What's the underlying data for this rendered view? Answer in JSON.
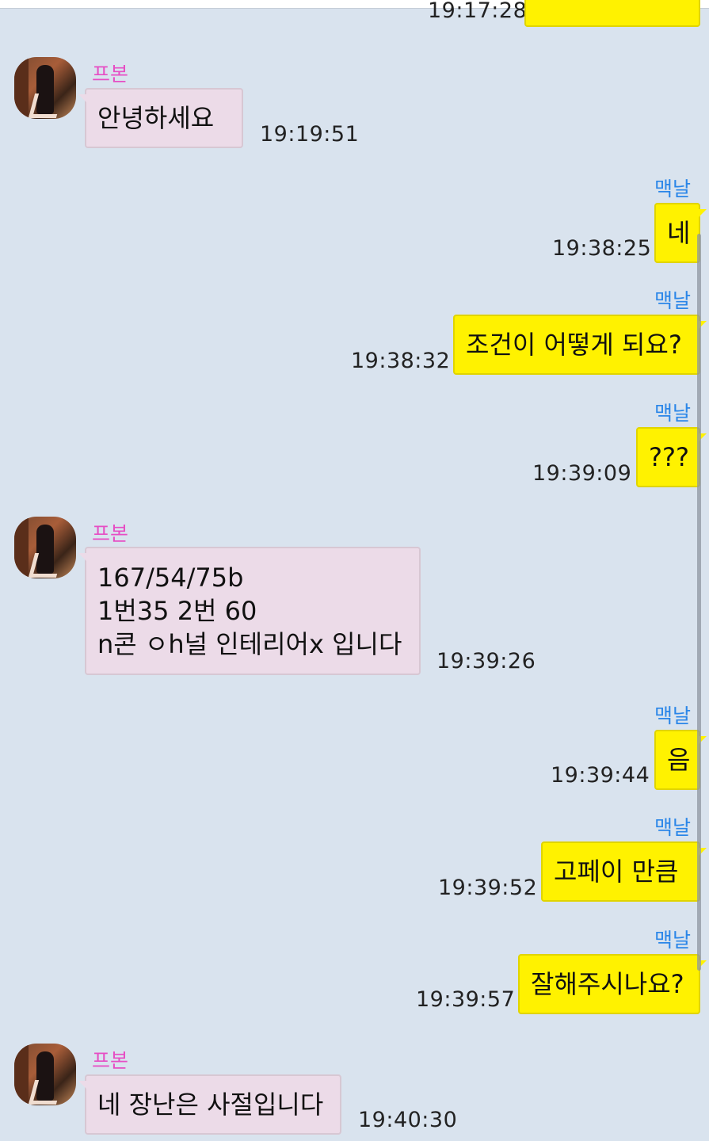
{
  "chat": {
    "partial_top": {
      "time": "19:17:28"
    },
    "messages": [
      {
        "sender": "프본",
        "text": "안녕하세요",
        "time": "19:19:51"
      },
      {
        "sender": "맥날",
        "text": "네",
        "time": "19:38:25"
      },
      {
        "sender": "맥날",
        "text": "조건이 어떻게 되요?",
        "time": "19:38:32"
      },
      {
        "sender": "맥날",
        "text": "???",
        "time": "19:39:09"
      },
      {
        "sender": "프본",
        "lines": [
          "167/54/75b",
          "1번35 2번 60",
          "n콘 ㅇh널 인테리어x 입니다"
        ],
        "time": "19:39:26"
      },
      {
        "sender": "맥날",
        "text": "음",
        "time": "19:39:44"
      },
      {
        "sender": "맥날",
        "text": "고페이 만큼",
        "time": "19:39:52"
      },
      {
        "sender": "맥날",
        "text": "잘해주시나요?",
        "time": "19:39:57"
      },
      {
        "sender": "프본",
        "text": "네 장난은 사절입니다",
        "time": "19:40:30"
      }
    ]
  },
  "colors": {
    "background": "#d9e3ee",
    "my_bubble": "#fff200",
    "other_bubble": "#ecdbe8",
    "my_name": "#2a86e8",
    "other_name": "#e64ec4"
  }
}
